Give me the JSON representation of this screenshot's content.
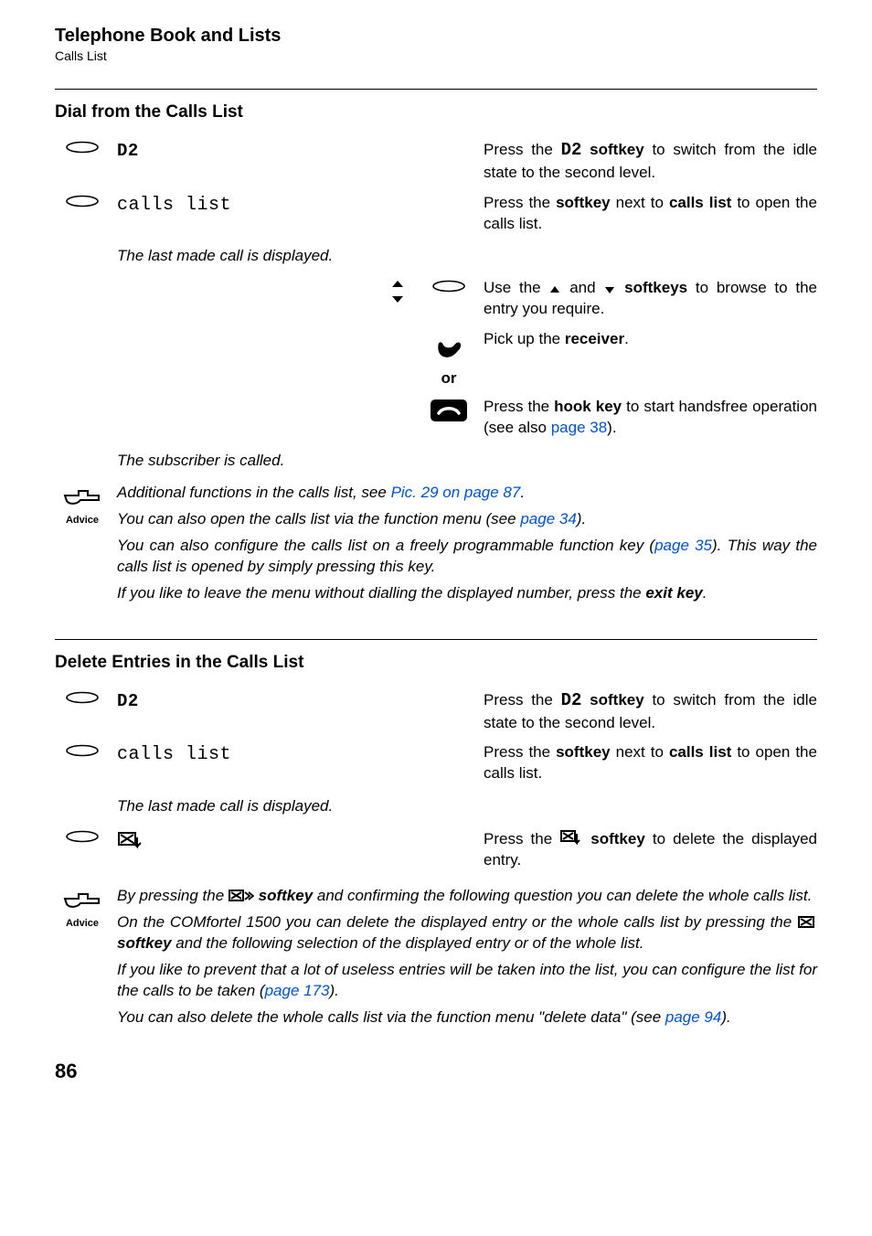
{
  "header": {
    "title": "Telephone Book and Lists",
    "subtitle": "Calls List"
  },
  "section1": {
    "title": "Dial from the Calls List",
    "row1_label": "D2",
    "row1_text_a": "Press the ",
    "row1_text_icon": "D2",
    "row1_text_b": " softkey",
    "row1_text_c": " to switch from the idle state to the second level.",
    "row2_label": "calls list",
    "row2_text_a": "Press the ",
    "row2_text_b": "softkey",
    "row2_text_c": " next to ",
    "row2_text_d": "calls list",
    "row2_text_e": " to open the calls list.",
    "row3_italic": "The last made call is displayed.",
    "row4_text_a": "Use the ",
    "row4_text_b": " and ",
    "row4_text_c": " softkeys",
    "row4_text_d": " to browse to the entry you require.",
    "row5_text_a": "Pick up the ",
    "row5_text_b": "receiver",
    "row5_text_c": ".",
    "or": "or",
    "row6_text_a": "Press the ",
    "row6_text_b": "hook key",
    "row6_text_c": " to start handsfree operation (see also ",
    "row6_link": "page 38",
    "row6_text_d": ").",
    "row7_italic": "The subscriber is called."
  },
  "advice1": {
    "label": "Advice",
    "p1_a": "Additional functions in the calls list, see ",
    "p1_link": "Pic. 29 on page 87",
    "p1_b": ".",
    "p2_a": "You can also open the calls list via the function menu (see ",
    "p2_link": "page 34",
    "p2_b": ").",
    "p3_a": "You can also configure the calls list on a freely programmable function key (",
    "p3_link": "page 35",
    "p3_b": "). This way the calls list is opened by simply pressing this key.",
    "p4_a": "If you like to leave the menu without dialling the displayed number, press the ",
    "p4_b": "exit key",
    "p4_c": "."
  },
  "section2": {
    "title": "Delete Entries in the Calls List",
    "row1_label": "D2",
    "row1_text_a": "Press the ",
    "row1_text_icon": "D2",
    "row1_text_b": " softkey",
    "row1_text_c": " to switch from the idle state to the second level.",
    "row2_label": "calls list",
    "row2_text_a": "Press the ",
    "row2_text_b": "softkey",
    "row2_text_c": " next to ",
    "row2_text_d": "calls list",
    "row2_text_e": " to open the calls list.",
    "row3_italic": "The last made call is displayed.",
    "row4_text_a": "Press the ",
    "row4_text_b": " softkey",
    "row4_text_c": " to delete the displayed entry."
  },
  "advice2": {
    "label": "Advice",
    "p1_a": "By pressing the ",
    "p1_b": " softkey",
    "p1_c": " and confirming the following question you can delete the whole calls list.",
    "p2_a": "On the COMfortel 1500 you can delete the displayed entry or the whole calls list by pressing the ",
    "p2_b": " softkey",
    "p2_c": " and the following selection of the displayed entry or of the whole list.",
    "p3_a": "If you like to prevent that a lot of useless entries will be taken into the list, you can configure the list for the calls to be taken (",
    "p3_link": "page 173",
    "p3_b": ").",
    "p4_a": "You can also delete the whole calls list via the function menu \"delete data\" (see ",
    "p4_link": "page 94",
    "p4_b": ")."
  },
  "page_number": "86"
}
